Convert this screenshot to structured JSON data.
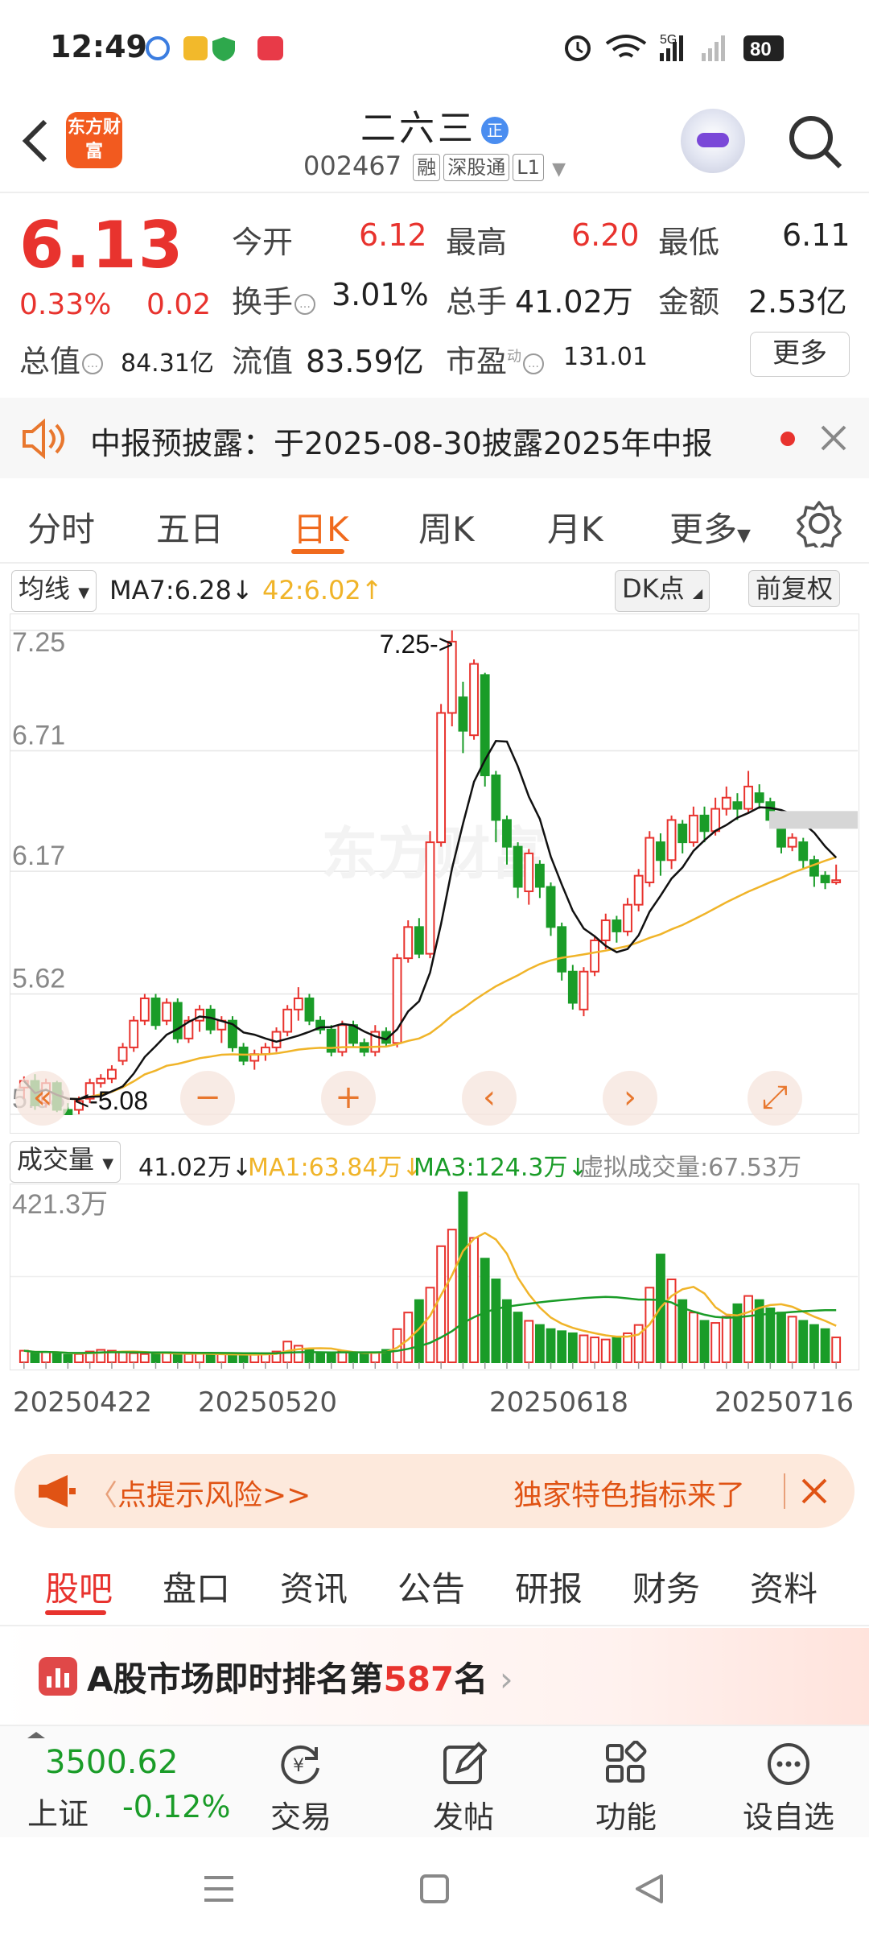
{
  "status_bar": {
    "time": "12:49",
    "network": "5G",
    "battery": "80"
  },
  "header": {
    "logo_text": "东方财富",
    "stock_name": "二六三",
    "badge": "正",
    "stock_code": "002467",
    "tags": [
      "融",
      "深股通",
      "L1"
    ]
  },
  "quote": {
    "price": "6.13",
    "change_pct": "0.33%",
    "change": "0.02",
    "open_label": "今开",
    "open": "6.12",
    "high_label": "最高",
    "high": "6.20",
    "low_label": "最低",
    "low": "6.11",
    "turnover_label": "换手",
    "turnover": "3.01%",
    "volume_label": "总手",
    "volume": "41.02万",
    "amount_label": "金额",
    "amount": "2.53亿",
    "mcap_label": "总值",
    "mcap": "84.31亿",
    "float_label": "流值",
    "float": "83.59亿",
    "pe_label": "市盈",
    "pe_sup": "动",
    "pe": "131.01",
    "more": "更多"
  },
  "notice": {
    "text": "中报预披露：于2025-08-30披露2025年中报"
  },
  "chart_tabs": [
    "分时",
    "五日",
    "日K",
    "周K",
    "月K",
    "更多"
  ],
  "chart_tabs_active": "日K",
  "ma_row": {
    "selector": "均线",
    "ma7": "MA7:6.28",
    "ma42": "42:6.02",
    "dk": "DK点",
    "adjust": "前复权"
  },
  "kline": {
    "watermark": "东方财富",
    "max_label": "7.25->",
    "min_label": "<-5.08"
  },
  "vol_row": {
    "selector": "成交量",
    "vol": "41.02万",
    "ma1": "MA1:63.84万",
    "ma3": "MA3:124.3万",
    "virtual": "虚拟成交量:67.53万"
  },
  "risk": {
    "left": "点提示风险>>",
    "right": "独家特色指标来了"
  },
  "info_tabs": [
    "股吧",
    "盘口",
    "资讯",
    "公告",
    "研报",
    "财务",
    "资料"
  ],
  "info_tabs_active": "股吧",
  "rank": {
    "prefix": "A股市场即时排名第",
    "rank": "587",
    "suffix": "名"
  },
  "bottom_bar": {
    "index_value": "3500.62",
    "index_name": "上证",
    "index_change": "-0.12%",
    "items": [
      "交易",
      "发帖",
      "功能",
      "设自选"
    ]
  },
  "colors": {
    "up": "#e8332e",
    "down": "#1a9c28",
    "accent": "#f06a1d",
    "ma_black": "#111111",
    "ma_yellow": "#f0b429"
  },
  "chart_data": [
    {
      "type": "candlestick",
      "title": "日K",
      "ylim": [
        5.08,
        7.25
      ],
      "y_ticks": [
        "7.25",
        "6.71",
        "6.17",
        "5.62",
        "5.08"
      ],
      "candles": [
        [
          5.2,
          5.23,
          5.15,
          5.25
        ],
        [
          5.23,
          5.12,
          5.1,
          5.26
        ],
        [
          5.13,
          5.22,
          5.11,
          5.24
        ],
        [
          5.22,
          5.1,
          5.09,
          5.23
        ],
        [
          5.1,
          5.08,
          5.08,
          5.13
        ],
        [
          5.1,
          5.14,
          5.08,
          5.16
        ],
        [
          5.15,
          5.22,
          5.13,
          5.24
        ],
        [
          5.22,
          5.24,
          5.2,
          5.26
        ],
        [
          5.24,
          5.28,
          5.22,
          5.3
        ],
        [
          5.32,
          5.38,
          5.3,
          5.4
        ],
        [
          5.38,
          5.5,
          5.36,
          5.52
        ],
        [
          5.5,
          5.6,
          5.48,
          5.62
        ],
        [
          5.6,
          5.48,
          5.46,
          5.62
        ],
        [
          5.5,
          5.58,
          5.48,
          5.6
        ],
        [
          5.58,
          5.42,
          5.4,
          5.6
        ],
        [
          5.42,
          5.5,
          5.4,
          5.52
        ],
        [
          5.5,
          5.55,
          5.45,
          5.57
        ],
        [
          5.55,
          5.46,
          5.44,
          5.57
        ],
        [
          5.46,
          5.5,
          5.4,
          5.52
        ],
        [
          5.5,
          5.38,
          5.36,
          5.52
        ],
        [
          5.38,
          5.32,
          5.3,
          5.4
        ],
        [
          5.32,
          5.35,
          5.28,
          5.37
        ],
        [
          5.35,
          5.38,
          5.32,
          5.4
        ],
        [
          5.38,
          5.45,
          5.36,
          5.47
        ],
        [
          5.45,
          5.55,
          5.43,
          5.57
        ],
        [
          5.55,
          5.6,
          5.5,
          5.65
        ],
        [
          5.6,
          5.5,
          5.48,
          5.62
        ],
        [
          5.5,
          5.46,
          5.44,
          5.52
        ],
        [
          5.46,
          5.36,
          5.34,
          5.48
        ],
        [
          5.36,
          5.48,
          5.34,
          5.5
        ],
        [
          5.48,
          5.4,
          5.38,
          5.5
        ],
        [
          5.4,
          5.36,
          5.34,
          5.42
        ],
        [
          5.36,
          5.45,
          5.34,
          5.48
        ],
        [
          5.45,
          5.4,
          5.38,
          5.47
        ],
        [
          5.4,
          5.78,
          5.38,
          5.8
        ],
        [
          5.78,
          5.92,
          5.76,
          5.95
        ],
        [
          5.92,
          5.8,
          5.78,
          5.96
        ],
        [
          5.8,
          6.3,
          5.78,
          6.35
        ],
        [
          6.3,
          6.88,
          6.28,
          6.92
        ],
        [
          6.88,
          7.2,
          6.82,
          7.25
        ],
        [
          6.95,
          6.8,
          6.7,
          7.02
        ],
        [
          6.78,
          7.1,
          6.76,
          7.12
        ],
        [
          7.05,
          6.6,
          6.55,
          7.06
        ],
        [
          6.6,
          6.4,
          6.3,
          6.62
        ],
        [
          6.4,
          6.28,
          6.2,
          6.42
        ],
        [
          6.28,
          6.1,
          6.05,
          6.3
        ],
        [
          6.08,
          6.25,
          6.02,
          6.27
        ],
        [
          6.2,
          6.1,
          6.05,
          6.22
        ],
        [
          6.1,
          5.92,
          5.88,
          6.12
        ],
        [
          5.92,
          5.72,
          5.68,
          5.94
        ],
        [
          5.72,
          5.58,
          5.55,
          5.75
        ],
        [
          5.55,
          5.72,
          5.52,
          5.74
        ],
        [
          5.72,
          5.86,
          5.7,
          5.88
        ],
        [
          5.86,
          5.95,
          5.82,
          5.98
        ],
        [
          5.95,
          5.9,
          5.85,
          5.97
        ],
        [
          5.9,
          6.02,
          5.88,
          6.05
        ],
        [
          6.02,
          6.15,
          5.99,
          6.18
        ],
        [
          6.12,
          6.32,
          6.1,
          6.35
        ],
        [
          6.3,
          6.22,
          6.15,
          6.34
        ],
        [
          6.22,
          6.4,
          6.18,
          6.42
        ],
        [
          6.38,
          6.3,
          6.25,
          6.4
        ],
        [
          6.3,
          6.42,
          6.28,
          6.46
        ],
        [
          6.42,
          6.35,
          6.3,
          6.46
        ],
        [
          6.35,
          6.45,
          6.33,
          6.5
        ],
        [
          6.45,
          6.5,
          6.42,
          6.55
        ],
        [
          6.48,
          6.45,
          6.4,
          6.52
        ],
        [
          6.45,
          6.55,
          6.43,
          6.62
        ],
        [
          6.52,
          6.48,
          6.45,
          6.56
        ],
        [
          6.48,
          6.4,
          6.38,
          6.5
        ],
        [
          6.4,
          6.28,
          6.25,
          6.42
        ],
        [
          6.28,
          6.32,
          6.26,
          6.34
        ],
        [
          6.3,
          6.22,
          6.18,
          6.32
        ],
        [
          6.22,
          6.15,
          6.1,
          6.24
        ],
        [
          6.15,
          6.12,
          6.09,
          6.17
        ],
        [
          6.12,
          6.13,
          6.11,
          6.2
        ]
      ],
      "candle_fields": [
        "open",
        "close",
        "low",
        "high"
      ]
    },
    {
      "type": "bar",
      "title": "成交量",
      "ylim": [
        0,
        421.3
      ],
      "y_ticks": [
        "421.3万"
      ],
      "x_ticks": [
        "20250422",
        "20250520",
        "20250618",
        "20250716"
      ],
      "values": [
        28,
        22,
        25,
        22,
        18,
        20,
        26,
        30,
        28,
        24,
        22,
        20,
        22,
        24,
        18,
        20,
        22,
        18,
        20,
        16,
        18,
        20,
        22,
        26,
        50,
        40,
        30,
        24,
        22,
        26,
        22,
        20,
        24,
        30,
        80,
        120,
        150,
        180,
        280,
        320,
        410,
        300,
        250,
        200,
        150,
        120,
        100,
        90,
        80,
        75,
        70,
        65,
        60,
        55,
        60,
        70,
        90,
        180,
        260,
        200,
        150,
        120,
        100,
        95,
        110,
        140,
        160,
        150,
        130,
        120,
        110,
        100,
        90,
        80,
        60
      ],
      "ma1_label": "MA1:63.84万",
      "ma3_label": "MA3:124.3万"
    }
  ]
}
